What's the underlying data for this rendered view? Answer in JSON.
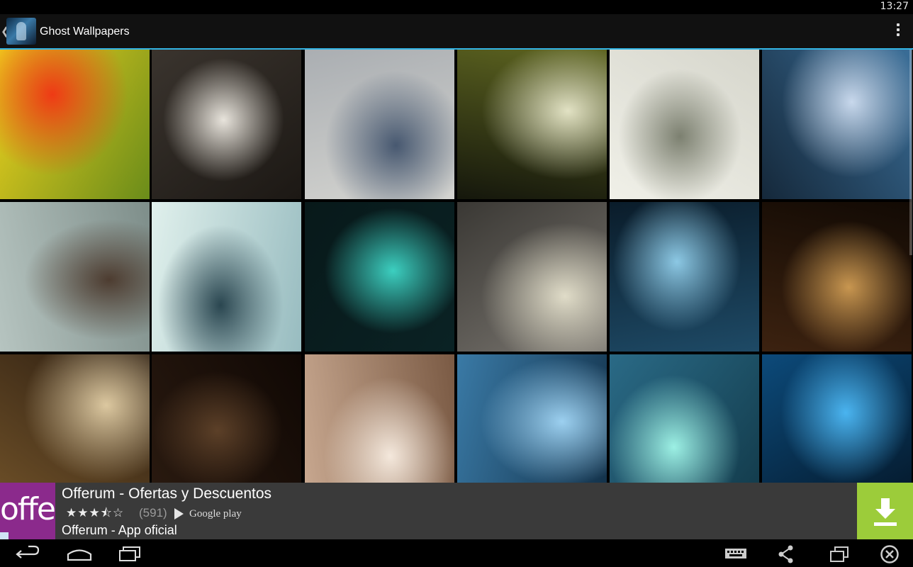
{
  "status_bar": {
    "time": "13:27"
  },
  "action_bar": {
    "title": "Ghost Wallpapers",
    "app_icon": "ghost-app-icon",
    "menu_icon": "overflow-menu-icon"
  },
  "grid": {
    "tiles": [
      {
        "name": "wallpaper-red-ghost",
        "colors": [
          "#f0d21e",
          "#ef3a15",
          "#6a8c1a"
        ]
      },
      {
        "name": "wallpaper-ghost-lights",
        "colors": [
          "#3a342e",
          "#e8e4dc",
          "#1c1814"
        ]
      },
      {
        "name": "wallpaper-gray-specters",
        "colors": [
          "#aaaeb2",
          "#475870",
          "#d4d4d0"
        ]
      },
      {
        "name": "wallpaper-ghost-bride",
        "colors": [
          "#5d6420",
          "#e2e2c4",
          "#15170c"
        ]
      },
      {
        "name": "wallpaper-ghostly-hand",
        "colors": [
          "#d6d6cc",
          "#7c8070",
          "#f0f0e8"
        ]
      },
      {
        "name": "wallpaper-boat-spirit",
        "colors": [
          "#3a6e98",
          "#c8d8ec",
          "#15283a"
        ]
      },
      {
        "name": "wallpaper-girl-with-ghosts",
        "colors": [
          "#7e8e8a",
          "#4d3c30",
          "#b6c4c0"
        ]
      },
      {
        "name": "wallpaper-haunted-room",
        "colors": [
          "#98bcc0",
          "#2a4650",
          "#e0f0ec"
        ]
      },
      {
        "name": "wallpaper-teal-phantom",
        "colors": [
          "#0a2224",
          "#3ccfc0",
          "#08191a"
        ]
      },
      {
        "name": "wallpaper-chapel-ghost",
        "colors": [
          "#7a7670",
          "#e0dcc8",
          "#3a3834"
        ]
      },
      {
        "name": "wallpaper-blue-forest",
        "colors": [
          "#1e4a66",
          "#8cc8e4",
          "#0a1c2a"
        ]
      },
      {
        "name": "wallpaper-dark-hallway",
        "colors": [
          "#3c2210",
          "#c89650",
          "#120a04"
        ]
      },
      {
        "name": "wallpaper-window-ghost",
        "colors": [
          "#6e5028",
          "#dcc8a0",
          "#2a1c10"
        ]
      },
      {
        "name": "wallpaper-dark-library",
        "colors": [
          "#2a1a10",
          "#5c4028",
          "#100804"
        ]
      },
      {
        "name": "wallpaper-sepia-gown",
        "colors": [
          "#c8a890",
          "#f4e8dc",
          "#7a5a44"
        ]
      },
      {
        "name": "wallpaper-blue-boy-ghost",
        "colors": [
          "#3a7aa6",
          "#9cd0f0",
          "#123048"
        ]
      },
      {
        "name": "wallpaper-mist-spirit",
        "colors": [
          "#2a6a86",
          "#9cf0e4",
          "#123a4a"
        ]
      },
      {
        "name": "wallpaper-blue-face",
        "colors": [
          "#0c4a7a",
          "#4ab4f0",
          "#04182a"
        ]
      }
    ]
  },
  "ad": {
    "logo_text": "offe",
    "title": "Offerum - Ofertas y Descuentos",
    "stars": "★★★⯪☆",
    "rating": 3.5,
    "rating_count": "(591)",
    "store_label": "Google play",
    "store_icon": "google-play-icon",
    "subtitle": "Offerum - App oficial",
    "download_icon": "download-icon",
    "colors": {
      "logo_bg": "#8b2a8c",
      "download_bg": "#9ccc3a",
      "bar_bg": "#3a3a3a"
    }
  },
  "nav_bar": {
    "buttons": [
      "back-icon",
      "home-icon",
      "recent-apps-icon"
    ],
    "right_icons": [
      "keyboard-icon",
      "share-icon",
      "window-icon",
      "close-circle-icon"
    ]
  }
}
